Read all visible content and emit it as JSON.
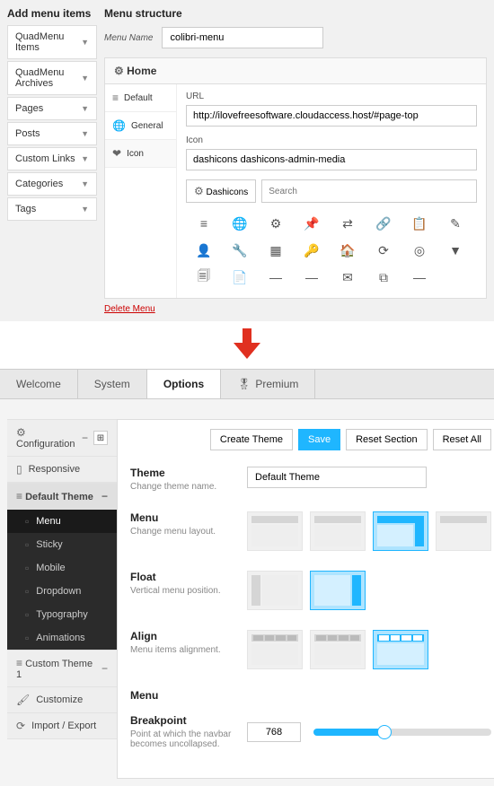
{
  "top": {
    "add_title": "Add menu items",
    "items": [
      "QuadMenu Items",
      "QuadMenu Archives",
      "Pages",
      "Posts",
      "Custom Links",
      "Categories",
      "Tags"
    ],
    "structure_title": "Menu structure",
    "menu_name_label": "Menu Name",
    "menu_name_value": "colibri-menu",
    "home_label": "Home",
    "detail_tabs": [
      "Default",
      "General",
      "Icon"
    ],
    "url_label": "URL",
    "url_value": "http://ilovefreesoftware.cloudaccess.host/#page-top",
    "icon_label": "Icon",
    "icon_value": "dashicons dashicons-admin-media",
    "dashicons_btn": "Dashicons",
    "search_placeholder": "Search",
    "delete_label": "Delete Menu"
  },
  "tabs": {
    "welcome": "Welcome",
    "system": "System",
    "options": "Options",
    "premium": "Premium"
  },
  "sidebar": {
    "configuration": "Configuration",
    "responsive": "Responsive",
    "default_theme": "Default Theme",
    "subs": [
      "Menu",
      "Sticky",
      "Mobile",
      "Dropdown",
      "Typography",
      "Animations"
    ],
    "custom_theme": "Custom Theme 1",
    "customize": "Customize",
    "import_export": "Import / Export"
  },
  "actions": {
    "create": "Create Theme",
    "save": "Save",
    "reset_section": "Reset Section",
    "reset_all": "Reset All"
  },
  "options": {
    "theme": {
      "title": "Theme",
      "desc": "Change theme name.",
      "value": "Default Theme"
    },
    "menu": {
      "title": "Menu",
      "desc": "Change menu layout."
    },
    "float": {
      "title": "Float",
      "desc": "Vertical menu position."
    },
    "align": {
      "title": "Align",
      "desc": "Menu items alignment."
    },
    "menu_section": "Menu",
    "breakpoint": {
      "title": "Breakpoint",
      "desc": "Point at which the navbar becomes uncollapsed.",
      "value": "768"
    }
  },
  "icon_glyphs": [
    "≡",
    "🌐",
    "⚙",
    "📌",
    "⇄",
    "🔗",
    "📋",
    "✎",
    "👤",
    "🔧",
    "▦",
    "🔑",
    "🏠",
    "⟳",
    "◎",
    "▼",
    "🗐",
    "📄",
    "—",
    "—",
    "✉",
    "⧉",
    "—"
  ]
}
